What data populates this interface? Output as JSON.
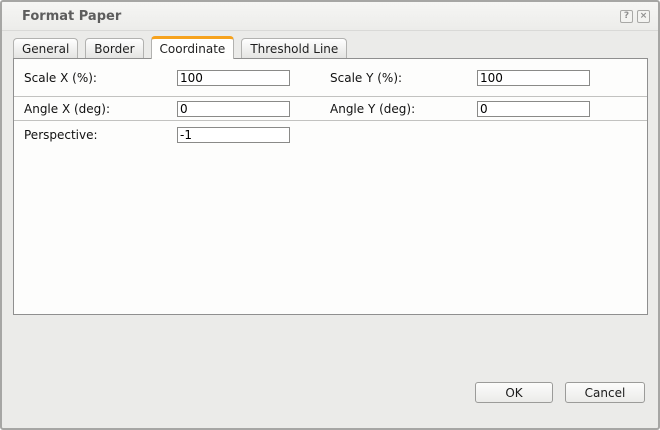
{
  "window": {
    "title": "Format Paper",
    "help_glyph": "?",
    "close_glyph": "×"
  },
  "tabs": [
    {
      "label": "General",
      "active": false
    },
    {
      "label": "Border",
      "active": false
    },
    {
      "label": "Coordinate",
      "active": true
    },
    {
      "label": "Threshold Line",
      "active": false
    }
  ],
  "form": {
    "rows": [
      {
        "left": {
          "label": "Scale X (%):",
          "value": "100"
        },
        "right": {
          "label": "Scale Y (%):",
          "value": "100"
        }
      },
      {
        "left": {
          "label": "Angle X (deg):",
          "value": "0"
        },
        "right": {
          "label": "Angle Y (deg):",
          "value": "0"
        }
      },
      {
        "left": {
          "label": "Perspective:",
          "value": "-1"
        }
      }
    ]
  },
  "footer": {
    "ok_label": "OK",
    "cancel_label": "Cancel"
  },
  "colors": {
    "accent_tab_orange": "#F6A21D",
    "panel_border": "#8F8F8F",
    "window_border": "#A6A6A4",
    "dialog_background": "#EBEBE9"
  }
}
